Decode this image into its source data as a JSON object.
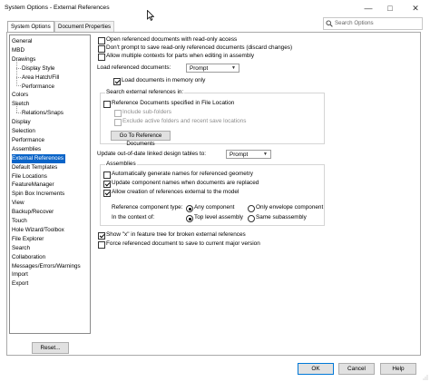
{
  "window": {
    "title": "System Options - External References",
    "minimize_glyph": "—",
    "maximize_glyph": "□",
    "close_glyph": "✕"
  },
  "tabs": [
    {
      "label": "System Options",
      "active": true
    },
    {
      "label": "Document Properties",
      "active": false
    }
  ],
  "search": {
    "placeholder": "Search Options",
    "icon": "search-icon"
  },
  "tree": {
    "items": [
      {
        "label": "General",
        "level": 0
      },
      {
        "label": "MBD",
        "level": 0
      },
      {
        "label": "Drawings",
        "level": 0
      },
      {
        "label": "Display Style",
        "level": 1
      },
      {
        "label": "Area Hatch/Fill",
        "level": 1
      },
      {
        "label": "Performance",
        "level": 1
      },
      {
        "label": "Colors",
        "level": 0
      },
      {
        "label": "Sketch",
        "level": 0
      },
      {
        "label": "Relations/Snaps",
        "level": 1
      },
      {
        "label": "Display",
        "level": 0
      },
      {
        "label": "Selection",
        "level": 0
      },
      {
        "label": "Performance",
        "level": 0
      },
      {
        "label": "Assemblies",
        "level": 0
      },
      {
        "label": "External References",
        "level": 0,
        "selected": true
      },
      {
        "label": "Default Templates",
        "level": 0
      },
      {
        "label": "File Locations",
        "level": 0
      },
      {
        "label": "FeatureManager",
        "level": 0
      },
      {
        "label": "Spin Box Increments",
        "level": 0
      },
      {
        "label": "View",
        "level": 0
      },
      {
        "label": "Backup/Recover",
        "level": 0
      },
      {
        "label": "Touch",
        "level": 0
      },
      {
        "label": "Hole Wizard/Toolbox",
        "level": 0
      },
      {
        "label": "File Explorer",
        "level": 0
      },
      {
        "label": "Search",
        "level": 0
      },
      {
        "label": "Collaboration",
        "level": 0
      },
      {
        "label": "Messages/Errors/Warnings",
        "level": 0
      },
      {
        "label": "Import",
        "level": 0
      },
      {
        "label": "Export",
        "level": 0
      }
    ],
    "reset_label": "Reset..."
  },
  "options": {
    "open_readonly": {
      "label": "Open referenced documents with read-only access",
      "checked": false
    },
    "dont_prompt": {
      "label": "Don't prompt to save read-only referenced documents (discard changes)",
      "checked": false
    },
    "multiple_contexts": {
      "label": "Allow multiple contexts for parts when editing in assembly",
      "checked": false
    },
    "load_refs_label": "Load referenced documents:",
    "load_refs_value": "Prompt",
    "load_in_memory": {
      "label": "Load documents in memory only",
      "checked": true
    },
    "search_group_title": "Search external references in:",
    "ref_docs_in_location": {
      "label": "Reference Documents specified in File Location",
      "checked": false
    },
    "include_subfolders": {
      "label": "Include sub-folders",
      "checked": false
    },
    "exclude_active": {
      "label": "Exclude active folders and recent save locations",
      "checked": false
    },
    "goto_button": "Go To Reference Documents",
    "update_label": "Update out-of-date linked design tables to:",
    "update_value": "Prompt",
    "assemblies_group_title": "Assemblies",
    "auto_names": {
      "label": "Automatically generate names for referenced geometry",
      "checked": false
    },
    "update_names": {
      "label": "Update component names when documents are replaced",
      "checked": true
    },
    "allow_creation": {
      "label": "Allow creation of references external to the model",
      "checked": true
    },
    "ref_component_type_label": "Reference component type:",
    "in_context_label": "In the context of:",
    "any_component": {
      "label": "Any component",
      "selected": true
    },
    "only_envelope": {
      "label": "Only envelope component",
      "selected": false
    },
    "top_level": {
      "label": "Top level assembly",
      "selected": true
    },
    "same_sub": {
      "label": "Same subassembly",
      "selected": false
    },
    "show_x": {
      "label": "Show \"x\" in feature tree for broken external references",
      "checked": true
    },
    "force_save": {
      "label": "Force referenced document to save to current major version",
      "checked": false
    }
  },
  "footer": {
    "ok": "OK",
    "cancel": "Cancel",
    "help": "Help"
  }
}
